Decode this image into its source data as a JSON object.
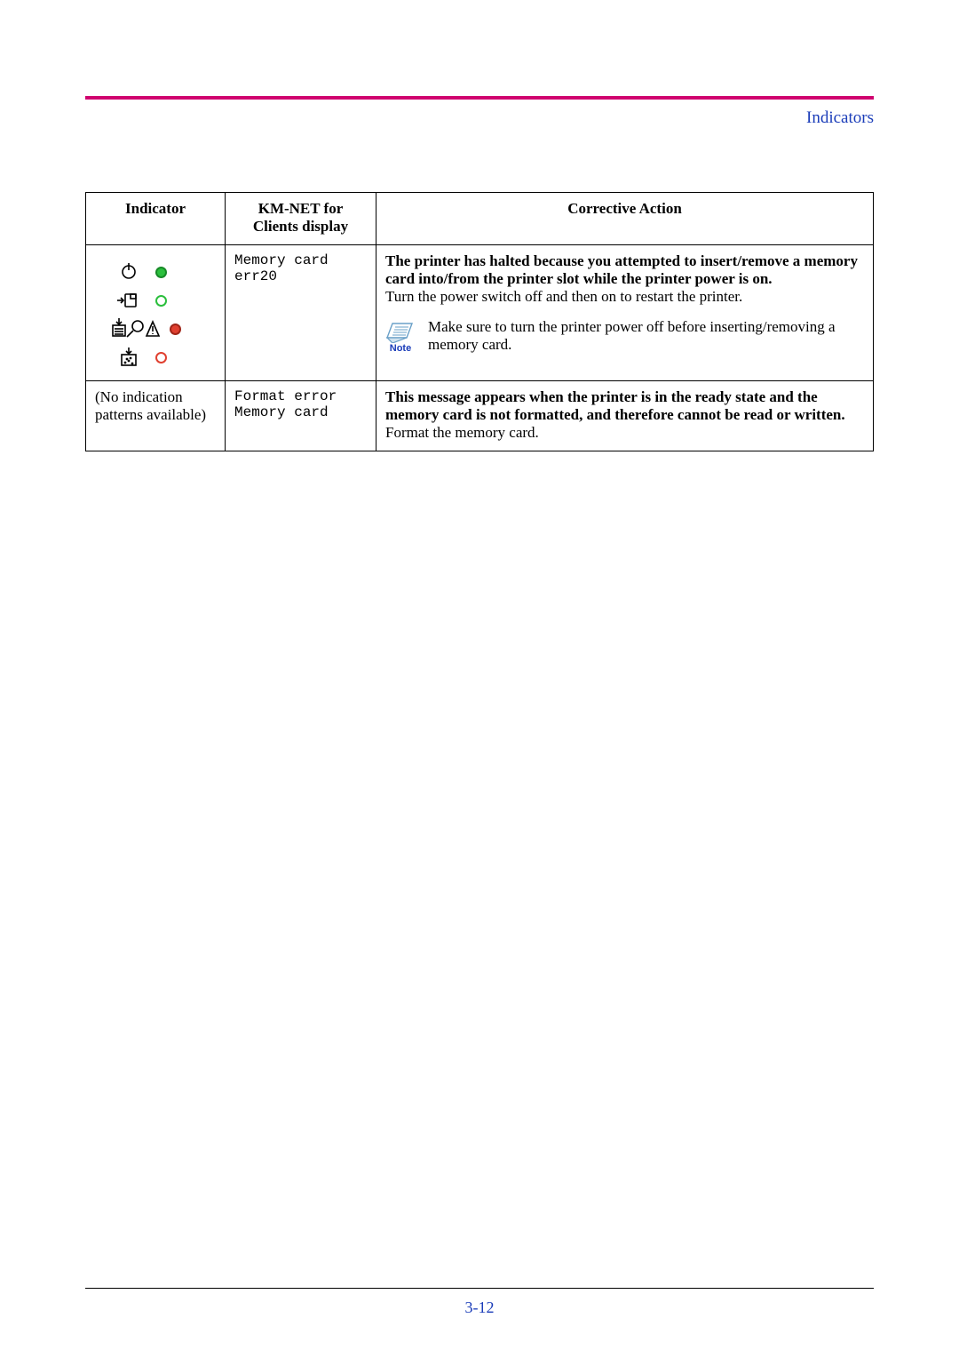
{
  "header": {
    "section_label": "Indicators"
  },
  "table": {
    "columns": {
      "indicator": "Indicator",
      "kmnet_line1": "KM-NET for",
      "kmnet_line2": "Clients display",
      "action": "Corrective Action"
    },
    "rows": [
      {
        "indicator_text": "",
        "kmnet": "Memory card err20",
        "action_bold": "The printer has halted because you attempted to insert/remove a memory card into/from the printer slot while the printer power is on.",
        "action_normal": "Turn the power switch off and then on to restart the printer.",
        "note_label": "Note",
        "note_text": "Make sure to turn the printer power off before inserting/removing a memory card."
      },
      {
        "indicator_text": "(No indication patterns available)",
        "kmnet_line1": "Format error",
        "kmnet_line2": "Memory card",
        "action_bold": "This message appears when the printer is in the ready state and the memory card is not formatted, and therefore cannot be read or written.",
        "action_normal": "Format the memory card."
      }
    ]
  },
  "footer": {
    "page_number": "3-12"
  },
  "indicator_panel": {
    "leds": [
      "solid-green",
      "ring-green",
      "solid-red",
      "ring-red"
    ],
    "icons": [
      "ready",
      "data",
      "paper-attention",
      "toner"
    ]
  }
}
